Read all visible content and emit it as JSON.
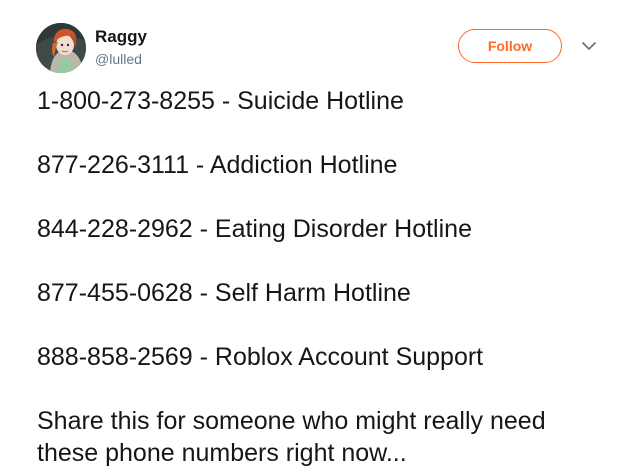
{
  "author": {
    "display_name": "Raggy",
    "handle": "@lulled",
    "avatar_icon": "avatar-icon"
  },
  "actions": {
    "follow_label": "Follow",
    "menu_icon": "chevron-down-icon"
  },
  "tweet": {
    "lines": [
      "1-800-273-8255 - Suicide Hotline",
      "877-226-3111 - Addiction Hotline",
      "844-228-2962 - Eating Disorder Hotline",
      "877-455-0628 - Self Harm Hotline",
      "888-858-2569 - Roblox Account Support"
    ],
    "closing": "Share this for someone who might really need these phone numbers right now..."
  },
  "colors": {
    "accent": "#ff6a2b",
    "text": "#14171a",
    "muted": "#657786"
  }
}
